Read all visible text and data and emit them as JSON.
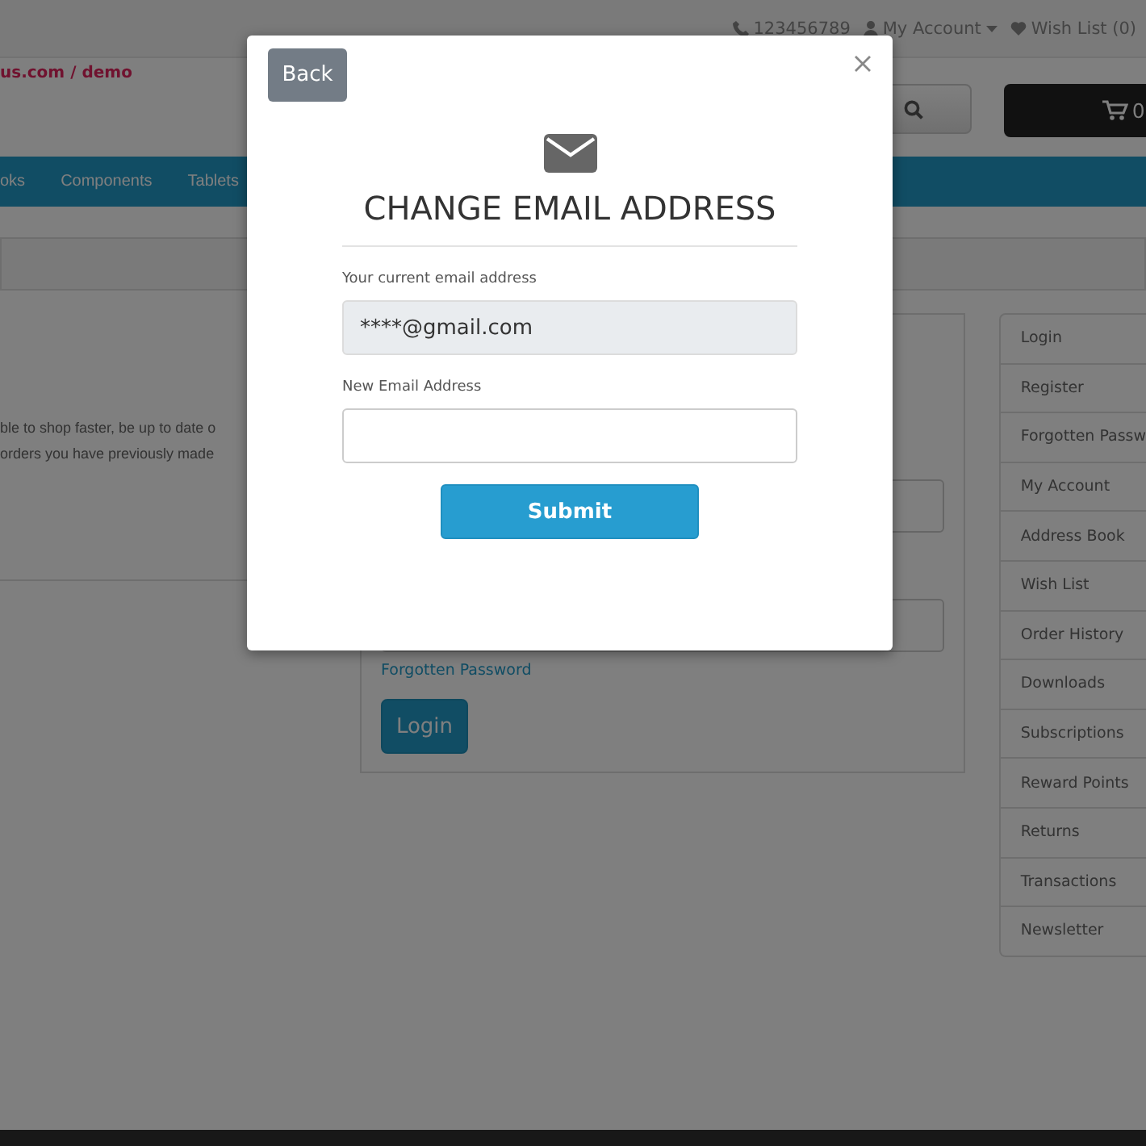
{
  "top_bar": {
    "phone": "123456789",
    "account": "My Account",
    "wishlist": "Wish List (0)"
  },
  "header": {
    "logo_text": "us.com / demo",
    "cart_count": "0"
  },
  "nav": {
    "items": [
      "oks",
      "Components",
      "Tablets"
    ]
  },
  "intro_text": [
    "ble to shop faster, be up to date o",
    "orders you have previously made"
  ],
  "login_form": {
    "link": "Forgotten Password",
    "button": "Login"
  },
  "sidebar": {
    "items": [
      "Login",
      "Register",
      "Forgotten Passw",
      "My Account",
      "Address Book",
      "Wish List",
      "Order History",
      "Downloads",
      "Subscriptions",
      "Reward Points",
      "Returns",
      "Transactions",
      "Newsletter"
    ]
  },
  "modal": {
    "back": "Back",
    "title": "CHANGE EMAIL ADDRESS",
    "fields": [
      {
        "label": "Your current email address",
        "value": "****@gmail.com",
        "disabled": true
      },
      {
        "label": "New Email Address",
        "disabled": false
      }
    ],
    "submit": "Submit"
  }
}
